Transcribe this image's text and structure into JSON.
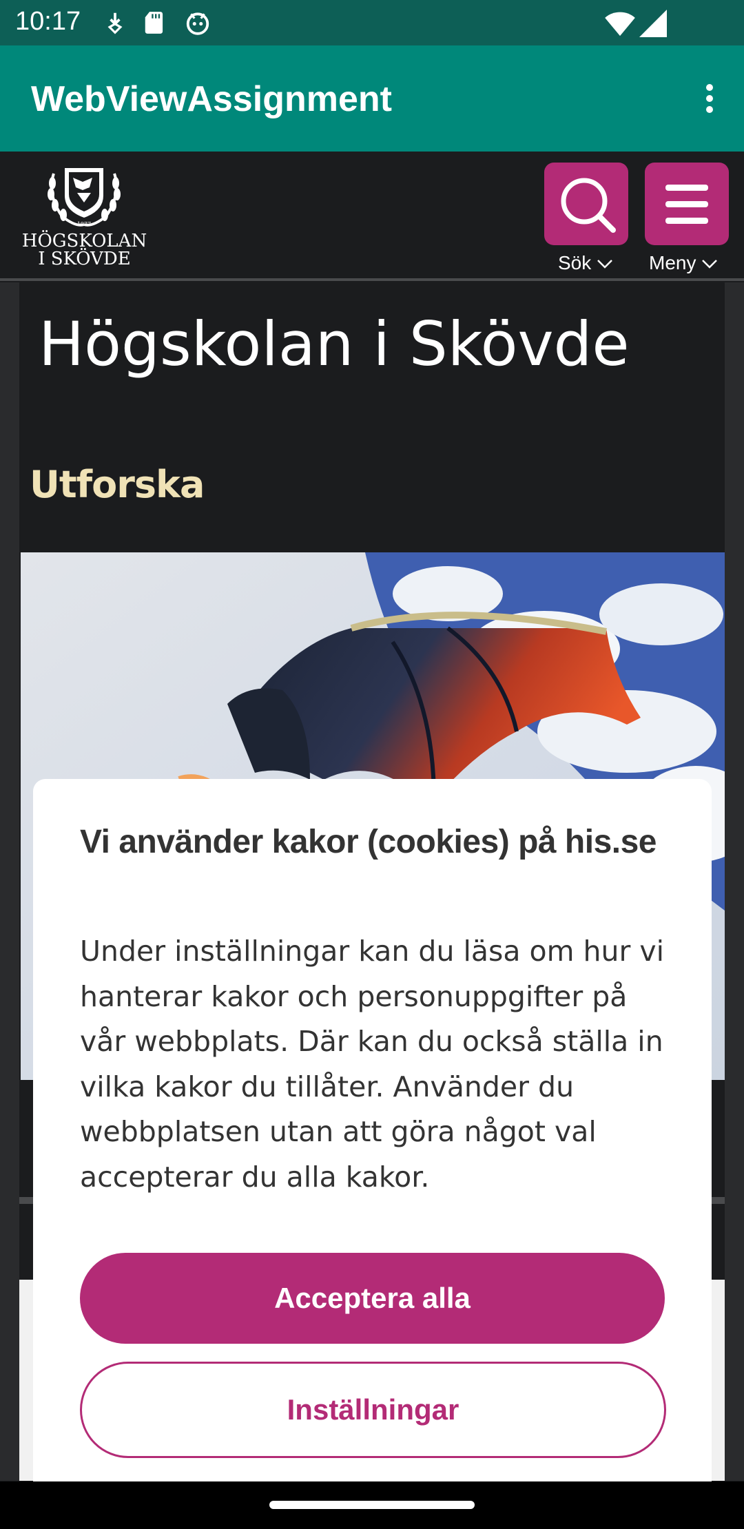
{
  "status_bar": {
    "time": "10:17",
    "left_icons": [
      "download-icon",
      "sd-card-icon",
      "android-icon"
    ],
    "right_icons": [
      "wifi-icon",
      "signal-icon"
    ]
  },
  "app_bar": {
    "title": "WebViewAssignment",
    "background": "#00887a",
    "overflow_icon": "more-vert-icon"
  },
  "site_header": {
    "logo_lines": [
      "HÖGSKOLAN",
      "I SKÖVDE"
    ],
    "logo_year": "1977",
    "search_label": "Sök",
    "menu_label": "Meny",
    "accent": "#b32b76"
  },
  "page": {
    "heading": "Högskolan i Skövde",
    "section_title": "Utforska"
  },
  "cookie_dialog": {
    "title": "Vi använder kakor (cookies) på his.se",
    "body": "Under inställningar kan du läsa om hur vi hanterar kakor och personuppgifter på vår webbplats. Där kan du också ställa in vilka kakor du tillåter. Använder du webbplatsen utan att göra något val accepterar du alla kakor.",
    "accept_label": "Acceptera alla",
    "settings_label": "Inställningar"
  }
}
